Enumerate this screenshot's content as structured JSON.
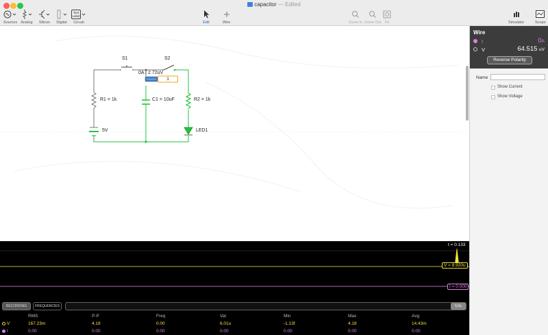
{
  "window": {
    "title": "capacitor",
    "separator": " — ",
    "status": "Edited"
  },
  "toolbar": {
    "sources": "Sources",
    "analog": "Analog",
    "silicon": "Silicon",
    "digital": "Digital",
    "circuit": "Circuit",
    "circuit_icon_text_top": "Text",
    "circuit_icon_text_bottom": "Label",
    "edit": "Edit",
    "wire": "Wire",
    "zoom_in": "Zoom In",
    "zoom_out": "Zoom Out",
    "fit": "Fit",
    "simulator": "Simulator",
    "scope": "Scope"
  },
  "circuit": {
    "s1": "S1",
    "s2": "S2",
    "r1": "R1 = 1k",
    "r2": "R2 = 1k",
    "c1": "C1 = 10uF",
    "battery": "5V",
    "led": "LED1",
    "probe_readout": "0A / 2.72uV",
    "probe_index": "1"
  },
  "inspector": {
    "title": "Wire",
    "current_label": "I",
    "current_value": "0",
    "current_unit": "A",
    "voltage_label": "V",
    "voltage_value": "64.515",
    "voltage_unit": "uV",
    "reverse_polarity": "Reverse Polarity",
    "name_label": "Name",
    "name_value": "",
    "show_current": "Show Current",
    "show_voltage": "Show Voltage"
  },
  "scope": {
    "time_readout": "t = 0.133",
    "v_readout": "V = 8.920u",
    "i_readout": "I = 0.000",
    "tab_recording": "RECORDING",
    "tab_frequencies": "FREQUENCIES",
    "timescale": "5.0s",
    "columns": [
      "RMS",
      "P-P",
      "Freq",
      "Val",
      "Min",
      "Max",
      "Avg"
    ],
    "rows": [
      {
        "label": "V",
        "values": [
          "167.23m",
          "4.18",
          "0.00",
          "6.01u",
          "-1.13f",
          "4.18",
          "14.43m"
        ]
      },
      {
        "label": "I",
        "values": [
          "0.00",
          "0.00",
          "0.00",
          "0.00",
          "0.00",
          "0.00",
          "0.00"
        ]
      }
    ]
  },
  "colors": {
    "voltage": "#f0e040",
    "current": "#e07fe8",
    "active_wire": "#22c43a",
    "inactive_wire": "#777777",
    "accent": "#2a62d8",
    "selection": "#f0a020"
  }
}
